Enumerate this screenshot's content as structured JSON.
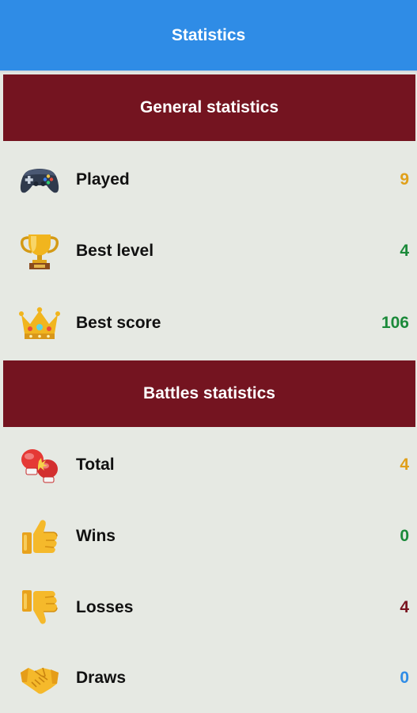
{
  "appbar": {
    "title": "Statistics"
  },
  "general": {
    "header": "General statistics",
    "played": {
      "icon": "game-controller-icon",
      "label": "Played",
      "value": "9",
      "color": "#e0a01a"
    },
    "best_level": {
      "icon": "trophy-icon",
      "label": "Best level",
      "value": "4",
      "color": "#1b8a3a"
    },
    "best_score": {
      "icon": "crown-icon",
      "label": "Best score",
      "value": "106",
      "color": "#1b8a3a"
    }
  },
  "battles": {
    "header": "Battles statistics",
    "total": {
      "icon": "boxing-gloves-icon",
      "label": "Total",
      "value": "4",
      "color": "#e0a01a"
    },
    "wins": {
      "icon": "thumbs-up-icon",
      "label": "Wins",
      "value": "0",
      "color": "#1b8a3a"
    },
    "losses": {
      "icon": "thumbs-down-icon",
      "label": "Losses",
      "value": "4",
      "color": "#7a1420"
    },
    "draws": {
      "icon": "handshake-icon",
      "label": "Draws",
      "value": "0",
      "color": "#2f8ce6"
    }
  }
}
